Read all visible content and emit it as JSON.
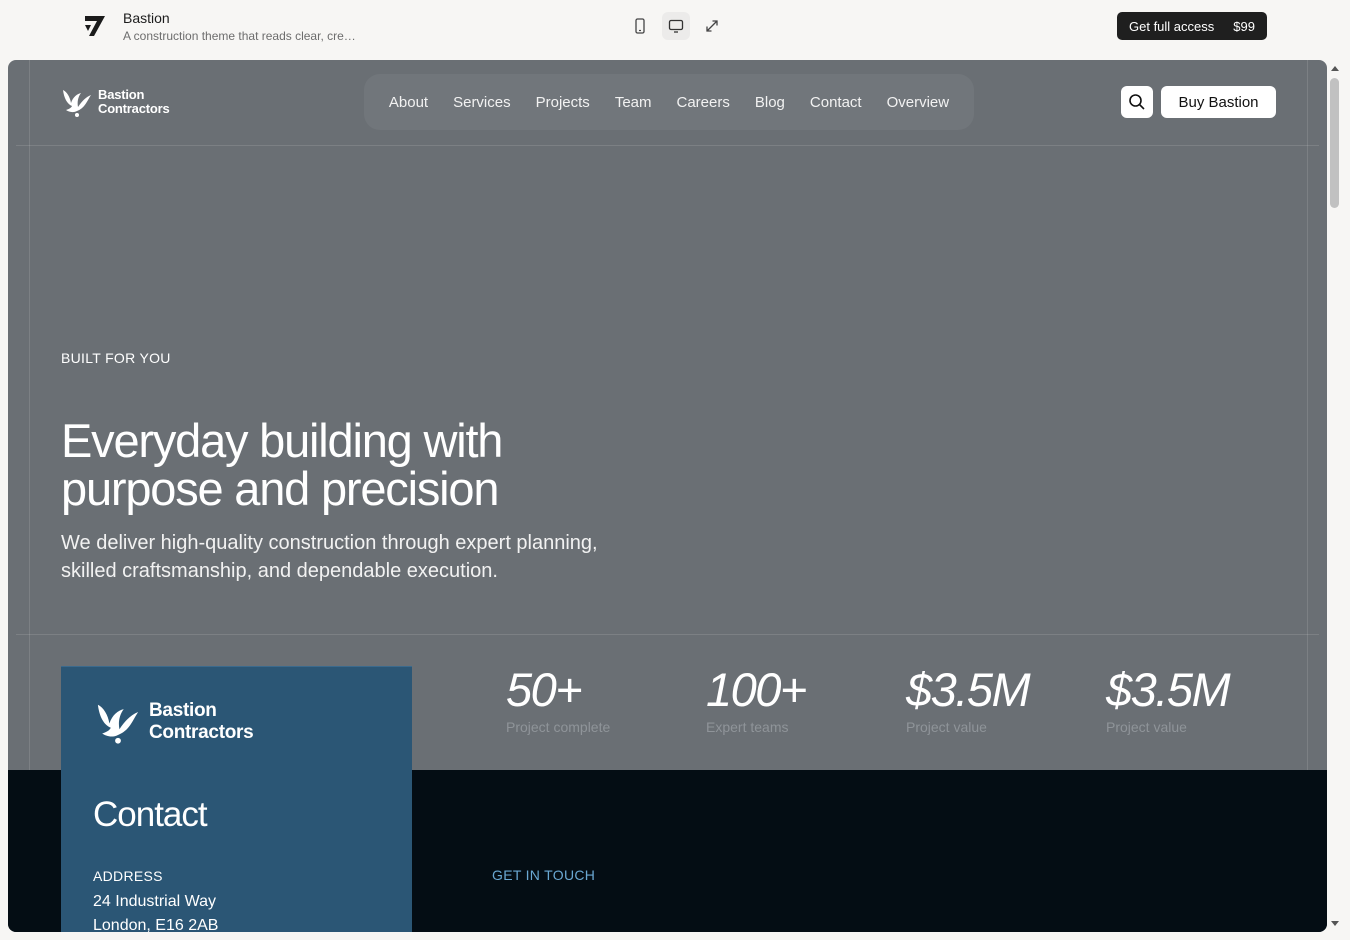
{
  "preview_bar": {
    "title": "Bastion",
    "subtitle": "A construction theme that reads clear, cre…",
    "access_label": "Get full access",
    "access_price": "$99",
    "view_modes": [
      "mobile-icon",
      "desktop-icon",
      "expand-icon"
    ],
    "active_view": "desktop"
  },
  "site": {
    "logo_line1": "Bastion",
    "logo_line2": "Contractors",
    "nav": [
      "About",
      "Services",
      "Projects",
      "Team",
      "Careers",
      "Blog",
      "Contact",
      "Overview"
    ],
    "buy_label": "Buy Bastion"
  },
  "hero": {
    "eyebrow": "BUILT FOR YOU",
    "title": "Everyday building with purpose and precision",
    "subtitle": "We deliver high-quality construction through expert planning, skilled craftsmanship, and dependable execution."
  },
  "stats": [
    {
      "value": "50+",
      "label": "Project complete"
    },
    {
      "value": "100+",
      "label": "Expert teams"
    },
    {
      "value": "$3.5M",
      "label": "Project value"
    },
    {
      "value": "$3.5M",
      "label": "Project value"
    }
  ],
  "contact_card": {
    "logo_line1": "Bastion",
    "logo_line2": "Contractors",
    "title": "Contact",
    "address_label": "ADDRESS",
    "address_line1": "24 Industrial Way",
    "address_line2": "London, E16 2AB"
  },
  "get_in_touch": "GET IN TOUCH",
  "colors": {
    "hero_bg": "#6a6f74",
    "dark_bg": "#040d14",
    "card_bg": "#2b5675",
    "accent_link": "#6aa8d3"
  }
}
